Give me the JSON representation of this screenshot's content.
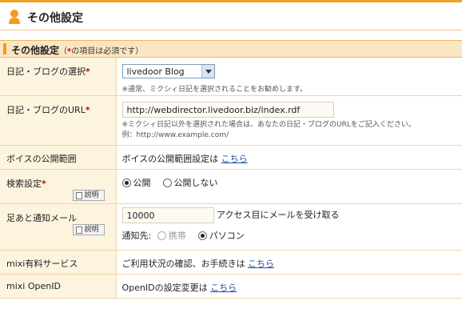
{
  "header": {
    "title": "その他設定"
  },
  "section": {
    "title": "その他設定",
    "note_open": "（",
    "note_star": "*",
    "note_text": "の項目は必須です）"
  },
  "rows": {
    "blog_select": {
      "label": "日記・ブログの選択",
      "selected": "livedoor Blog",
      "hint": "※通常、ミクシィ日記を選択されることをお勧めします。"
    },
    "blog_url": {
      "label": "日記・ブログのURL",
      "value": "http://webdirector.livedoor.biz/index.rdf",
      "hint1": "※ミクシィ日記以外を選択された場合は、あなたの日記・ブログのURLをご記入ください。",
      "hint2": "例：http://www.example.com/"
    },
    "voice": {
      "label": "ボイスの公開範囲",
      "text": "ボイスの公開範囲設定は",
      "link": "こちら"
    },
    "search": {
      "label": "検索設定",
      "explain": "説明",
      "opt_public": "公開",
      "opt_private": "公開しない"
    },
    "footprint": {
      "label": "足あと通知メール",
      "explain": "説明",
      "value": "10000",
      "suffix": "アクセス目にメールを受け取る",
      "notify_label": "通知先:",
      "opt_mobile": "携帯",
      "opt_pc": "パソコン"
    },
    "paid": {
      "label": "mixi有料サービス",
      "text": "ご利用状況の確認、お手続きは",
      "link": "こちら"
    },
    "openid": {
      "label": "mixi OpenID",
      "text": "OpenIDの設定変更は",
      "link": "こちら"
    }
  },
  "required_mark": "*",
  "colors": {
    "accent": "#f39a1e",
    "label_bg": "#fdf4e0",
    "section_bg": "#fbe6c3",
    "link": "#1d4faa",
    "required": "#d40000"
  }
}
